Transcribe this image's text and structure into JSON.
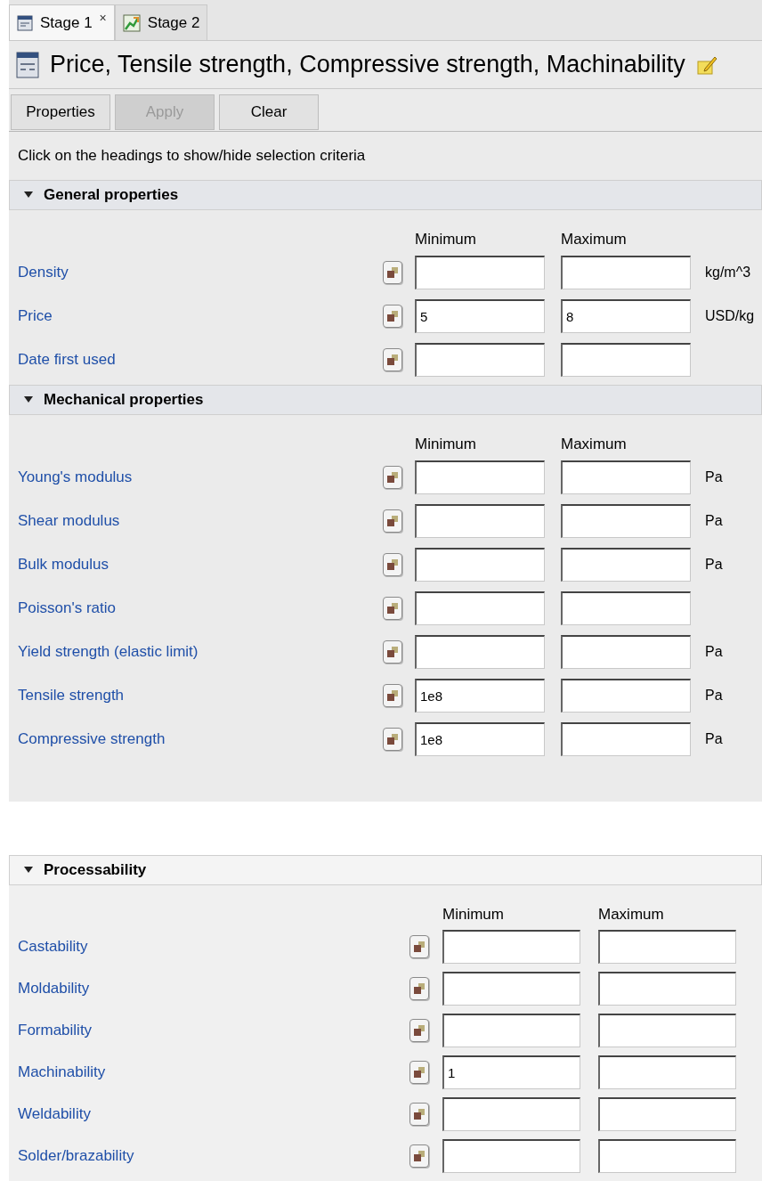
{
  "tabs": [
    {
      "label": "Stage 1",
      "selected": true,
      "close": "×",
      "kind": "table"
    },
    {
      "label": "Stage 2",
      "selected": false,
      "kind": "chart"
    }
  ],
  "title": "Price, Tensile strength, Compressive strength, Machinability",
  "toolbar": [
    {
      "label": "Properties",
      "disabled": false
    },
    {
      "label": "Apply",
      "disabled": true
    },
    {
      "label": "Clear",
      "disabled": false
    }
  ],
  "hint": "Click on the headings to show/hide selection criteria",
  "sections": [
    {
      "heading": "General properties",
      "expanded": true,
      "min_label": "Minimum",
      "max_label": "Maximum",
      "rows": [
        {
          "label": "Density",
          "min": "",
          "max": "",
          "unit": "kg/m^3"
        },
        {
          "label": "Price",
          "min": "5",
          "max": "8",
          "unit": "USD/kg"
        },
        {
          "label": "Date first used",
          "min": "",
          "max": ""
        }
      ]
    },
    {
      "heading": "Mechanical properties",
      "expanded": true,
      "min_label": "Minimum",
      "max_label": "Maximum",
      "rows": [
        {
          "label": "Young's modulus",
          "min": "",
          "max": "",
          "unit": "Pa"
        },
        {
          "label": "Shear modulus",
          "min": "",
          "max": "",
          "unit": "Pa"
        },
        {
          "label": "Bulk modulus",
          "min": "",
          "max": "",
          "unit": "Pa"
        },
        {
          "label": "Poisson's ratio",
          "min": "",
          "max": ""
        },
        {
          "label": "Yield strength (elastic limit)",
          "min": "",
          "max": "",
          "unit": "Pa"
        },
        {
          "label": "Tensile strength",
          "min": "1e8",
          "max": "",
          "unit": "Pa"
        },
        {
          "label": "Compressive strength",
          "min": "1e8",
          "max": "",
          "unit": "Pa"
        }
      ]
    }
  ],
  "processability": {
    "heading": "Processability",
    "expanded": true,
    "min_label": "Minimum",
    "max_label": "Maximum",
    "rows": [
      {
        "label": "Castability",
        "min": "",
        "max": ""
      },
      {
        "label": "Moldability",
        "min": "",
        "max": ""
      },
      {
        "label": "Formability",
        "min": "",
        "max": ""
      },
      {
        "label": "Machinability",
        "min": "1",
        "max": ""
      },
      {
        "label": "Weldability",
        "min": "",
        "max": ""
      },
      {
        "label": "Solder/brazability",
        "min": "",
        "max": ""
      }
    ]
  }
}
